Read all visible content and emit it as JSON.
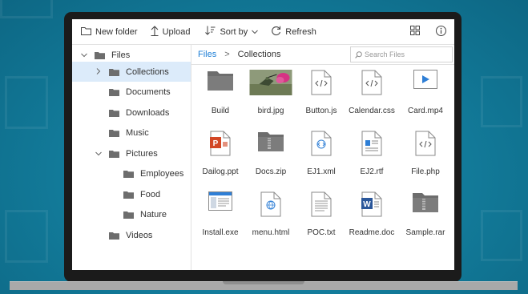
{
  "toolbar": {
    "new_folder": "New folder",
    "upload": "Upload",
    "sort_by": "Sort by",
    "refresh": "Refresh"
  },
  "tree": {
    "items": [
      {
        "label": "Files",
        "expanded": true
      },
      {
        "label": "Collections",
        "expanded": false,
        "selected": true
      },
      {
        "label": "Documents"
      },
      {
        "label": "Downloads"
      },
      {
        "label": "Music"
      },
      {
        "label": "Pictures",
        "expanded": true
      },
      {
        "label": "Employees"
      },
      {
        "label": "Food"
      },
      {
        "label": "Nature"
      },
      {
        "label": "Videos"
      }
    ]
  },
  "breadcrumb": {
    "root": "Files",
    "separator": ">",
    "current": "Collections"
  },
  "search": {
    "placeholder": "Search Files"
  },
  "files": [
    {
      "name": "Build",
      "icon": "folder-icon"
    },
    {
      "name": "bird.jpg",
      "icon": "image-thumbnail"
    },
    {
      "name": "Button.js",
      "icon": "code-file-icon"
    },
    {
      "name": "Calendar.css",
      "icon": "code-file-icon"
    },
    {
      "name": "Card.mp4",
      "icon": "video-file-icon"
    },
    {
      "name": "Dailog.ppt",
      "icon": "powerpoint-icon"
    },
    {
      "name": "Docs.zip",
      "icon": "zip-icon"
    },
    {
      "name": "EJ1.xml",
      "icon": "xml-file-icon"
    },
    {
      "name": "EJ2.rtf",
      "icon": "rtf-file-icon"
    },
    {
      "name": "File.php",
      "icon": "code-file-icon"
    },
    {
      "name": "Install.exe",
      "icon": "exe-file-icon"
    },
    {
      "name": "menu.html",
      "icon": "html-file-icon"
    },
    {
      "name": "POC.txt",
      "icon": "text-file-icon"
    },
    {
      "name": "Readme.doc",
      "icon": "word-icon"
    },
    {
      "name": "Sample.rar",
      "icon": "rar-icon"
    }
  ],
  "colors": {
    "accent": "#1c7ed6",
    "selected_bg": "#dcebfa",
    "folder": "#6d6d6d",
    "powerpoint": "#d24726",
    "word": "#2b579a"
  }
}
